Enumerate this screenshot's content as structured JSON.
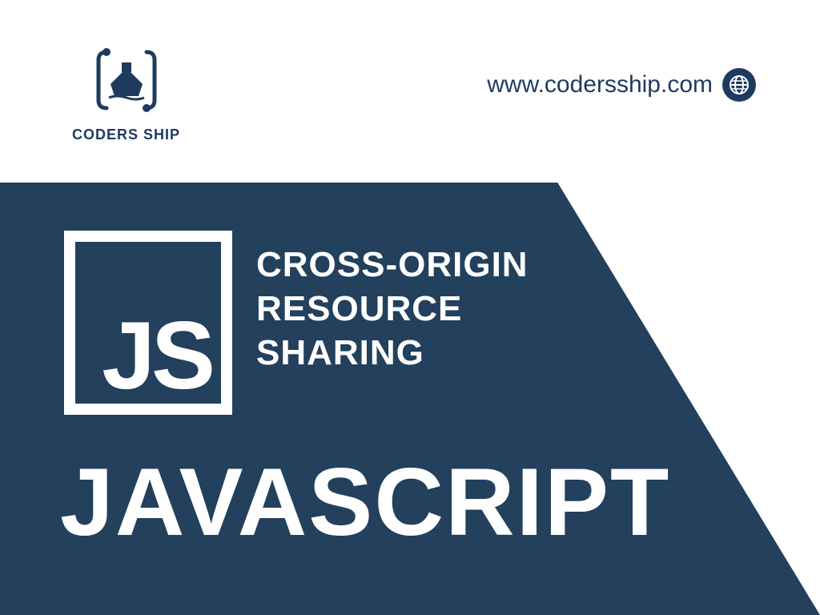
{
  "logo": {
    "text": "CODERS SHIP"
  },
  "url": "www.codersship.com",
  "js_label": "JS",
  "subtitle": {
    "line1": "CROSS-ORIGIN",
    "line2": "RESOURCE",
    "line3": "SHARING"
  },
  "title": "JAVASCRIPT",
  "colors": {
    "primary": "#23405c",
    "accent": "#1e3a5f",
    "white": "#ffffff"
  }
}
